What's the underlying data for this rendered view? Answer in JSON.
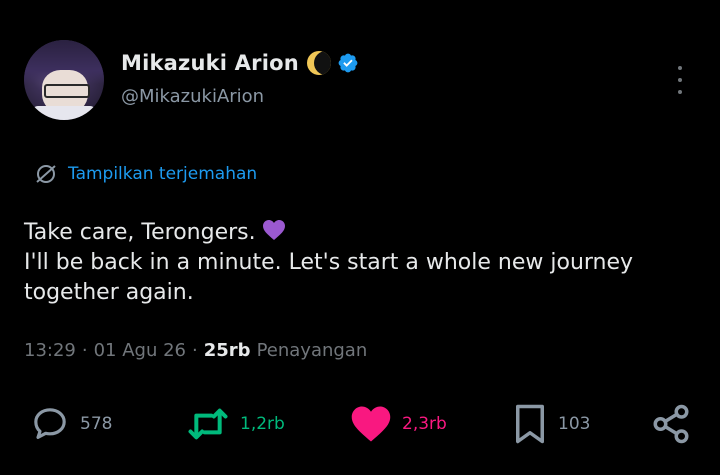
{
  "profile": {
    "display_name": "Mikazuki Arion",
    "handle": "@MikazukiArion",
    "name_emoji": "crescent-moon-icon",
    "verified": true
  },
  "translate": {
    "label": "Tampilkan terjemahan",
    "icon": "globe-icon"
  },
  "tweet": {
    "lines": [
      "Take care, Terongers.",
      "I'll be back in a minute. Let's start a whole new journey",
      "together again."
    ],
    "emoji": "purple-heart"
  },
  "meta": {
    "time": "13:29",
    "date": "01 Agu 26",
    "separator": "·",
    "views_count": "25rb",
    "views_label": "Penayangan"
  },
  "actions": {
    "reply_count": "578",
    "retweet_count": "1,2rb",
    "like_count": "2,3rb",
    "bookmark_count": "103"
  },
  "colors": {
    "background": "#000000",
    "text_primary": "#e7e9ea",
    "text_secondary": "#71767b",
    "link_blue": "#1d9bf0",
    "retweet_green": "#00ba7c",
    "like_pink": "#f91880"
  }
}
